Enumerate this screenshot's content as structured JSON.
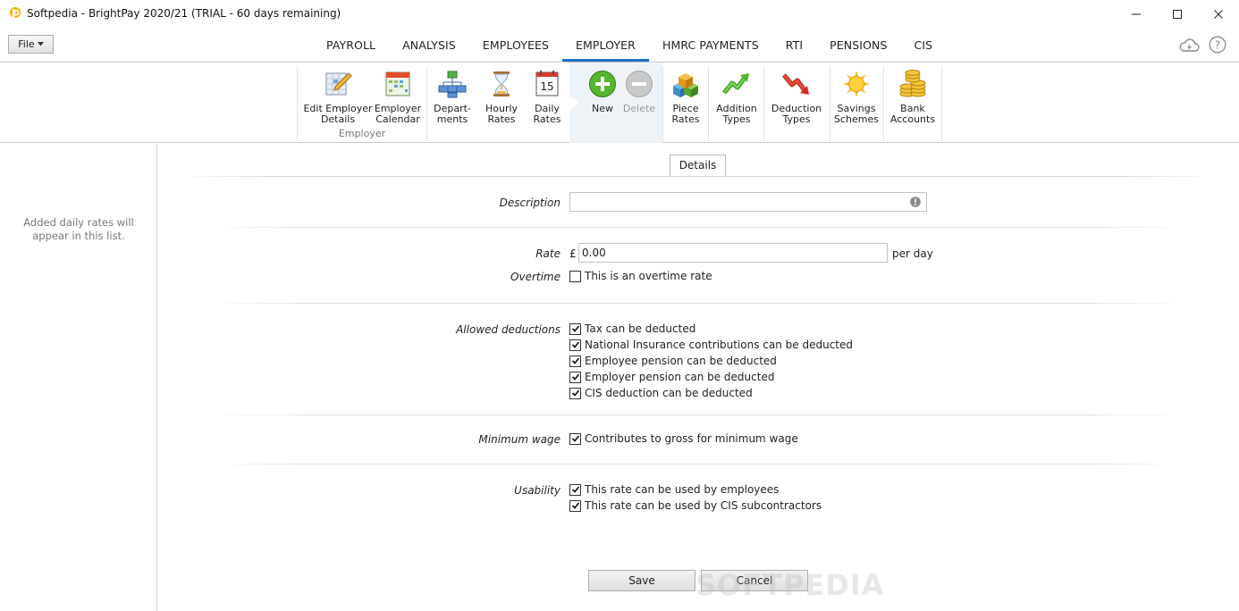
{
  "window": {
    "title": "Softpedia - BrightPay 2020/21 (TRIAL - 60 days remaining)"
  },
  "menu": {
    "file_label": "File"
  },
  "nav": {
    "tabs": [
      {
        "label": "PAYROLL"
      },
      {
        "label": "ANALYSIS"
      },
      {
        "label": "EMPLOYEES"
      },
      {
        "label": "EMPLOYER",
        "active": true
      },
      {
        "label": "HMRC PAYMENTS"
      },
      {
        "label": "RTI"
      },
      {
        "label": "PENSIONS"
      },
      {
        "label": "CIS"
      }
    ]
  },
  "ribbon": {
    "edit_employer": "Edit Employer\nDetails",
    "employer_calendar": "Employer\nCalendar",
    "departments": "Depart-\nments",
    "hourly_rates": "Hourly\nRates",
    "daily_rates": "Daily\nRates",
    "calendar_day": "15",
    "group_label": "Employer",
    "new": "New",
    "delete": "Delete",
    "piece_rates": "Piece\nRates",
    "addition_types": "Addition\nTypes",
    "deduction_types": "Deduction\nTypes",
    "savings_schemes": "Savings\nSchemes",
    "bank_accounts": "Bank\nAccounts"
  },
  "left_pane": {
    "empty_text": "Added daily rates will\nappear in this list."
  },
  "form": {
    "tab_label": "Details",
    "description_label": "Description",
    "description_value": "",
    "rate_label": "Rate",
    "currency": "£",
    "rate_value": "0.00",
    "rate_unit": "per day",
    "overtime_label": "Overtime",
    "overtime_text": "This is an overtime rate",
    "overtime_checked": false,
    "allowed_deductions_label": "Allowed deductions",
    "deductions": [
      {
        "text": "Tax can be deducted",
        "checked": true
      },
      {
        "text": "National Insurance contributions can be deducted",
        "checked": true
      },
      {
        "text": "Employee pension can be deducted",
        "checked": true
      },
      {
        "text": "Employer pension can be deducted",
        "checked": true
      },
      {
        "text": "CIS deduction can be deducted",
        "checked": true
      }
    ],
    "minimum_wage_label": "Minimum wage",
    "minimum_wage_text": "Contributes to gross for minimum wage",
    "minimum_wage_checked": true,
    "usability_label": "Usability",
    "usability": [
      {
        "text": "This rate can be used by employees",
        "checked": true
      },
      {
        "text": "This rate can be used by CIS subcontractors",
        "checked": true
      }
    ],
    "save_label": "Save",
    "cancel_label": "Cancel"
  },
  "watermark": "SOFTPEDIA",
  "colors": {
    "accent": "#1f6fc5",
    "new_bg": "#eef3f8"
  }
}
